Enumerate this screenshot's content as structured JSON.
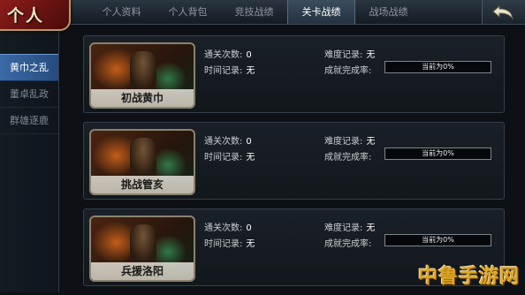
{
  "header": {
    "badge": "个人",
    "tabs": [
      {
        "label": "个人资料",
        "active": false
      },
      {
        "label": "个人背包",
        "active": false
      },
      {
        "label": "竞技战绩",
        "active": false
      },
      {
        "label": "关卡战绩",
        "active": true
      },
      {
        "label": "战场战绩",
        "active": false
      }
    ],
    "back_icon": "back-arrow-icon"
  },
  "sidebar": {
    "items": [
      {
        "label": "黄巾之乱",
        "active": true
      },
      {
        "label": "董卓乱政",
        "active": false
      },
      {
        "label": "群雄逐鹿",
        "active": false
      }
    ]
  },
  "labels": {
    "clear_count": "通关次数:",
    "time_record": "时间记录:",
    "difficulty_record": "难度记录:",
    "completion_rate": "成就完成率:"
  },
  "stages": [
    {
      "name": "初战黄巾",
      "clear_count": "0",
      "time_record": "无",
      "difficulty_record": "无",
      "completion_text": "当前为0%",
      "completion_value": 0
    },
    {
      "name": "挑战管亥",
      "clear_count": "0",
      "time_record": "无",
      "difficulty_record": "无",
      "completion_text": "当前为0%",
      "completion_value": 0
    },
    {
      "name": "兵援洛阳",
      "clear_count": "0",
      "time_record": "无",
      "difficulty_record": "无",
      "completion_text": "当前为0%",
      "completion_value": 0
    }
  ],
  "watermark": "中鲁手游网",
  "colors": {
    "accent_active_tab": "#3b4d5e",
    "sidebar_active": "#3a6aa8",
    "badge_red": "#8c1d1a",
    "watermark": "#f0b429"
  }
}
